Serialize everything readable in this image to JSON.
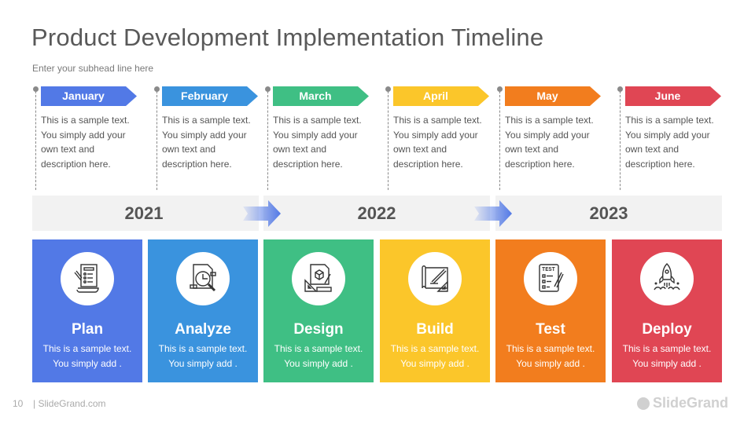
{
  "header": {
    "title": "Product Development Implementation Timeline",
    "subhead": "Enter your subhead line here"
  },
  "months": [
    {
      "label": "January",
      "color": "#5279e6",
      "desc": [
        "This is a sample text.",
        "You simply add your",
        "own text  and",
        "description here."
      ]
    },
    {
      "label": "February",
      "color": "#3a93de",
      "desc": [
        "This is a sample text.",
        "You simply add your",
        "own text  and",
        "description here."
      ]
    },
    {
      "label": "March",
      "color": "#3fbf84",
      "desc": [
        "This is a sample text.",
        "You simply add your",
        "own text  and",
        "description here."
      ]
    },
    {
      "label": "April",
      "color": "#fbc62a",
      "desc": [
        "This is a sample text.",
        "You simply add your",
        "own text  and",
        "description here."
      ]
    },
    {
      "label": "May",
      "color": "#f27d1e",
      "desc": [
        "This is a sample text.",
        "You simply add your",
        "own text  and",
        "description here."
      ]
    },
    {
      "label": "June",
      "color": "#e04654",
      "desc": [
        "This is a sample text.",
        "You simply add your",
        "own text  and",
        "description here."
      ]
    }
  ],
  "years": [
    "2021",
    "2022",
    "2023"
  ],
  "phases": [
    {
      "title": "Plan",
      "icon": "checklist-document-icon",
      "color": "#5279e6",
      "desc": [
        "This is a sample text.",
        "You simply add ."
      ]
    },
    {
      "title": "Analyze",
      "icon": "document-magnifier-chart-icon",
      "color": "#3a93de",
      "desc": [
        "This is a sample text.",
        "You simply add ."
      ]
    },
    {
      "title": "Design",
      "icon": "design-cube-ruler-icon",
      "color": "#3fbf84",
      "desc": [
        "This is a sample text.",
        "You simply add ."
      ]
    },
    {
      "title": "Build",
      "icon": "blueprint-pencil-icon",
      "color": "#fbc62a",
      "desc": [
        "This is a sample text.",
        "You simply add ."
      ]
    },
    {
      "title": "Test",
      "icon": "test-checklist-icon",
      "color": "#f27d1e",
      "desc": [
        "This is a sample text.",
        "You simply add ."
      ]
    },
    {
      "title": "Deploy",
      "icon": "rocket-launch-icon",
      "color": "#e04654",
      "desc": [
        "This is a sample text.",
        "You simply add ."
      ]
    }
  ],
  "footer": {
    "page_number": "10",
    "site": "| SlideGrand.com",
    "brand": "SlideGrand"
  }
}
